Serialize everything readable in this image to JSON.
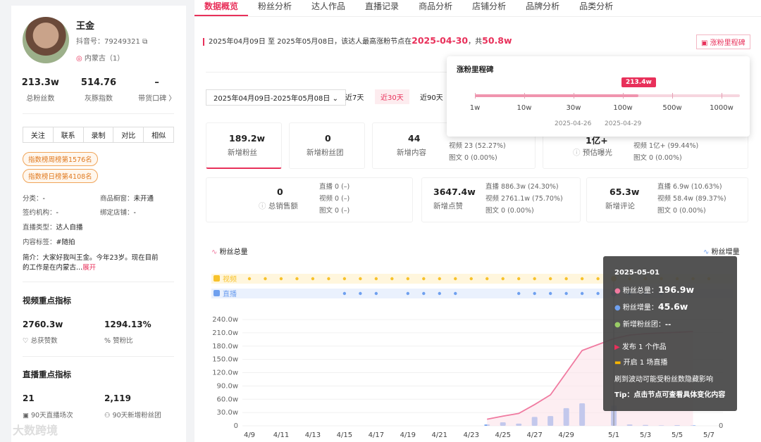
{
  "profile": {
    "name": "王金",
    "douyin_id": "抖音号：79249321",
    "location": "内蒙古（1）",
    "stats": [
      {
        "value": "213.3w",
        "label": "总粉丝数"
      },
      {
        "value": "514.76",
        "label": "灰豚指数"
      },
      {
        "value": "–",
        "label": "带货口碑 〉"
      }
    ],
    "buttons": [
      "关注",
      "联系",
      "录制",
      "对比",
      "相似"
    ],
    "tags": [
      "指数榜周榜第1576名",
      "指数榜日榜第4108名"
    ],
    "info": {
      "category_label": "分类：",
      "category": "-",
      "window_label": "商品橱窗：",
      "window": "未开通",
      "org_label": "签约机构：",
      "org": "-",
      "shop_label": "绑定店铺：",
      "shop": "-",
      "live_type_label": "直播类型：",
      "live_type": "达人自播",
      "content_label": "内容标签：",
      "content": "#随拍",
      "bio_line1": "简介：大家好我叫王金。今年23岁。现在目前",
      "bio_line2": "的工作是在内蒙古...",
      "expand": "展开"
    },
    "video_section": {
      "title": "视频重点指标",
      "v1": "2760.3w",
      "l1": "总获赞数",
      "v2": "1294.13%",
      "l2": "赞粉比"
    },
    "live_section": {
      "title": "直播重点指标",
      "v1": "21",
      "l1": "90天直播场次",
      "v2": "2,119",
      "l2": "90天新增粉丝团"
    },
    "watermark": "大数跨境"
  },
  "tabs": [
    "数据概览",
    "粉丝分析",
    "达人作品",
    "直播记录",
    "商品分析",
    "店铺分析",
    "品牌分析",
    "品类分析"
  ],
  "headline": {
    "pre": "2025年04月09日 至 2025年05月08日，该达人最高涨粉节点在",
    "date": "2025-04-30",
    "mid": "，共",
    "amount": "50.8w"
  },
  "milestone_btn": "涨粉里程碑",
  "date_range": "2025年04月09日-2025年05月08日",
  "ranges": [
    "近7天",
    "近30天",
    "近90天"
  ],
  "popup": {
    "title": "涨粉里程碑",
    "badge": "213.4w",
    "scale": [
      "1w",
      "10w",
      "30w",
      "100w",
      "500w",
      "1000w"
    ],
    "dates": [
      "2025-04-26",
      "2025-04-29"
    ]
  },
  "cards": {
    "c1": {
      "value": "189.2w",
      "label": "新增粉丝"
    },
    "c2": {
      "value": "0",
      "label": "新增粉丝团"
    },
    "c3": {
      "value": "44",
      "label": "新增内容",
      "s1": "视频  23  (52.27%)",
      "s2": "图文  0  (0.00%)"
    },
    "c4": {
      "value": "1亿+",
      "label": "预估曝光",
      "s1": "视频  1亿+  (99.44%)",
      "s2": "图文  0  (0.00%)"
    },
    "c5": {
      "value": "0",
      "label": "总销售额",
      "s1": "直播  0  (–)",
      "s2": "视频  0  (–)",
      "s3": "图文  0  (–)"
    },
    "c6": {
      "value": "3647.4w",
      "label": "新增点赞",
      "s1": "直播  886.3w  (24.30%)",
      "s2": "视频  2761.1w  (75.70%)",
      "s3": "图文  0  (0.00%)"
    },
    "c7": {
      "value": "65.3w",
      "label": "新增评论",
      "s1": "直播  6.9w  (10.63%)",
      "s2": "视频  58.4w  (89.37%)",
      "s3": "图文  0  (0.00%)"
    }
  },
  "chart_data": {
    "type": "bar",
    "legend_left": "粉丝总量",
    "legend_right": "粉丝增量",
    "track_labels": [
      "视频",
      "直播"
    ],
    "y_ticks": [
      "240.0w",
      "210.0w",
      "180.0w",
      "150.0w",
      "120.0w",
      "90.0w",
      "60.0w",
      "30.0w",
      "0"
    ],
    "y_right_ticks": [
      "0"
    ],
    "x_ticks": [
      "4/9",
      "4/11",
      "4/13",
      "4/15",
      "4/17",
      "4/19",
      "4/21",
      "4/23",
      "4/25",
      "4/27",
      "4/29",
      "5/1",
      "5/3",
      "5/5",
      "5/7"
    ],
    "ylim": [
      0,
      240
    ],
    "bar_dates": [
      "4/24",
      "4/25",
      "4/26",
      "4/27",
      "4/28",
      "4/29",
      "4/30",
      "5/1",
      "5/2",
      "5/3",
      "5/4",
      "5/5",
      "5/6"
    ],
    "bar_values": [
      3,
      8,
      5,
      20,
      22,
      40,
      50.8,
      45.6,
      3,
      2,
      1,
      1.5,
      1
    ],
    "line_values": [
      15,
      22,
      28,
      48,
      70,
      120,
      170,
      196.9,
      205,
      208,
      210,
      211,
      213
    ]
  },
  "tooltip": {
    "date": "2025-05-01",
    "r1_label": "粉丝总量：",
    "r1_value": "196.9w",
    "r2_label": "粉丝增量：",
    "r2_value": "45.6w",
    "r3_label": "新增粉丝团：",
    "r3_value": "--",
    "act1": "发布 1 个作品",
    "act2": "开启 1 场直播",
    "note": "刷到波动可能受粉丝数隐藏影响",
    "tip": "Tip：点击节点可查看具体变化内容"
  },
  "colors": {
    "accent": "#e8305a",
    "bar": "#6fa0ef",
    "line": "#f07aa0"
  }
}
